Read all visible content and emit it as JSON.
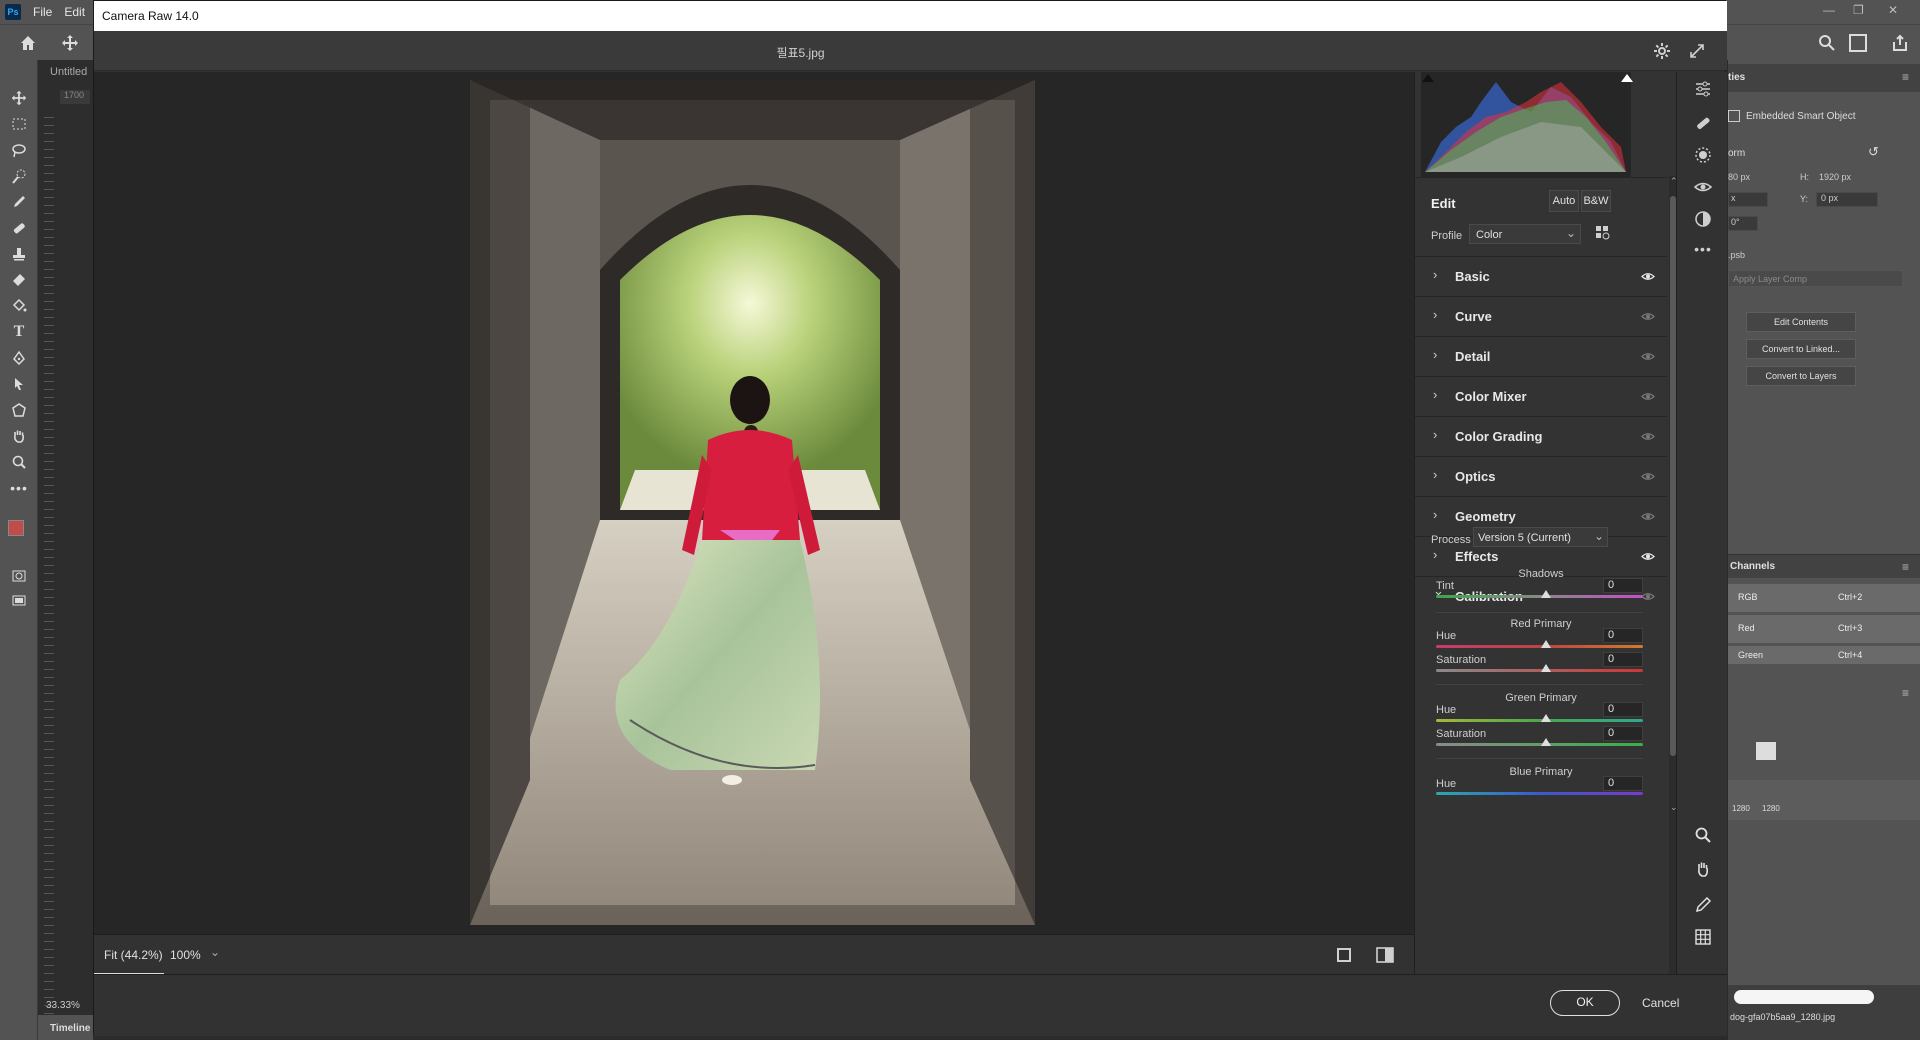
{
  "ps": {
    "logo": "Ps",
    "menu": [
      "File",
      "Edit"
    ],
    "doc_tab": "Untitled",
    "ruler_value": "1700",
    "zoom_status": "33.33%",
    "timeline_label": "Timeline",
    "tools": [
      "move-tool-icon",
      "marquee-tool-icon",
      "lasso-tool-icon",
      "quick-select-icon",
      "eyedropper-icon",
      "healing-brush-icon",
      "stamp-icon",
      "eraser-icon",
      "paint-bucket-icon",
      "type-tool-icon",
      "pen-tool-icon",
      "path-select-icon",
      "shape-tool-icon",
      "hand-tool-icon",
      "zoom-tool-icon",
      "more-tools-icon"
    ],
    "fg_color": "#c24b4b",
    "bg_color": "#ffffff"
  },
  "props": {
    "tab_label": "ties",
    "smart_object_label": "Embedded Smart Object",
    "transform_label": "orm",
    "w_value": "80 px",
    "h_label": "H:",
    "h_value": "1920 px",
    "x_value": "x",
    "y_label": "Y:",
    "y_value": "0 px",
    "angle_value": "0°",
    "file_label": ".psb",
    "layer_comp_placeholder": "Apply Layer Comp",
    "buttons": [
      "Edit Contents",
      "Convert to Linked...",
      "Convert to Layers"
    ]
  },
  "channels": {
    "tab_label": "Channels",
    "rows": [
      {
        "name": "RGB",
        "shortcut": "Ctrl+2"
      },
      {
        "name": "Red",
        "shortcut": "Ctrl+3"
      },
      {
        "name": "Green",
        "shortcut": "Ctrl+4"
      }
    ]
  },
  "layers": {
    "thumb_labels": [
      "1280",
      "1280"
    ],
    "file_label": "dog-gfa07b5aa9_1280.jpg"
  },
  "cr": {
    "title": "Camera Raw 14.0",
    "filename": "필표5.jpg",
    "edit_label": "Edit",
    "auto_label": "Auto",
    "bw_label": "B&W",
    "profile_label": "Profile",
    "profile_value": "Color",
    "sections": [
      {
        "label": "Basic",
        "expanded": false
      },
      {
        "label": "Curve",
        "expanded": false
      },
      {
        "label": "Detail",
        "expanded": false
      },
      {
        "label": "Color Mixer",
        "expanded": false
      },
      {
        "label": "Color Grading",
        "expanded": false
      },
      {
        "label": "Optics",
        "expanded": false
      },
      {
        "label": "Geometry",
        "expanded": false
      },
      {
        "label": "Effects",
        "expanded": false
      },
      {
        "label": "Calibration",
        "expanded": true
      }
    ],
    "calibration": {
      "process_label": "Process",
      "process_value": "Version 5 (Current)",
      "shadows_label": "Shadows",
      "tint_label": "Tint",
      "tint_value": "0",
      "red_primary_label": "Red Primary",
      "red_hue_label": "Hue",
      "red_hue_value": "0",
      "red_sat_label": "Saturation",
      "red_sat_value": "0",
      "green_primary_label": "Green Primary",
      "green_hue_label": "Hue",
      "green_hue_value": "0",
      "green_sat_label": "Saturation",
      "green_sat_value": "0",
      "blue_primary_label": "Blue Primary",
      "blue_hue_label": "Hue",
      "blue_hue_value": "0"
    },
    "zoom_fit_label": "Fit (44.2%)",
    "zoom_100_label": "100%",
    "ok_label": "OK",
    "cancel_label": "Cancel",
    "colors": {
      "dialog_bg": "#323232",
      "canvas_bg": "#262626",
      "panel_bg": "#333333"
    }
  }
}
